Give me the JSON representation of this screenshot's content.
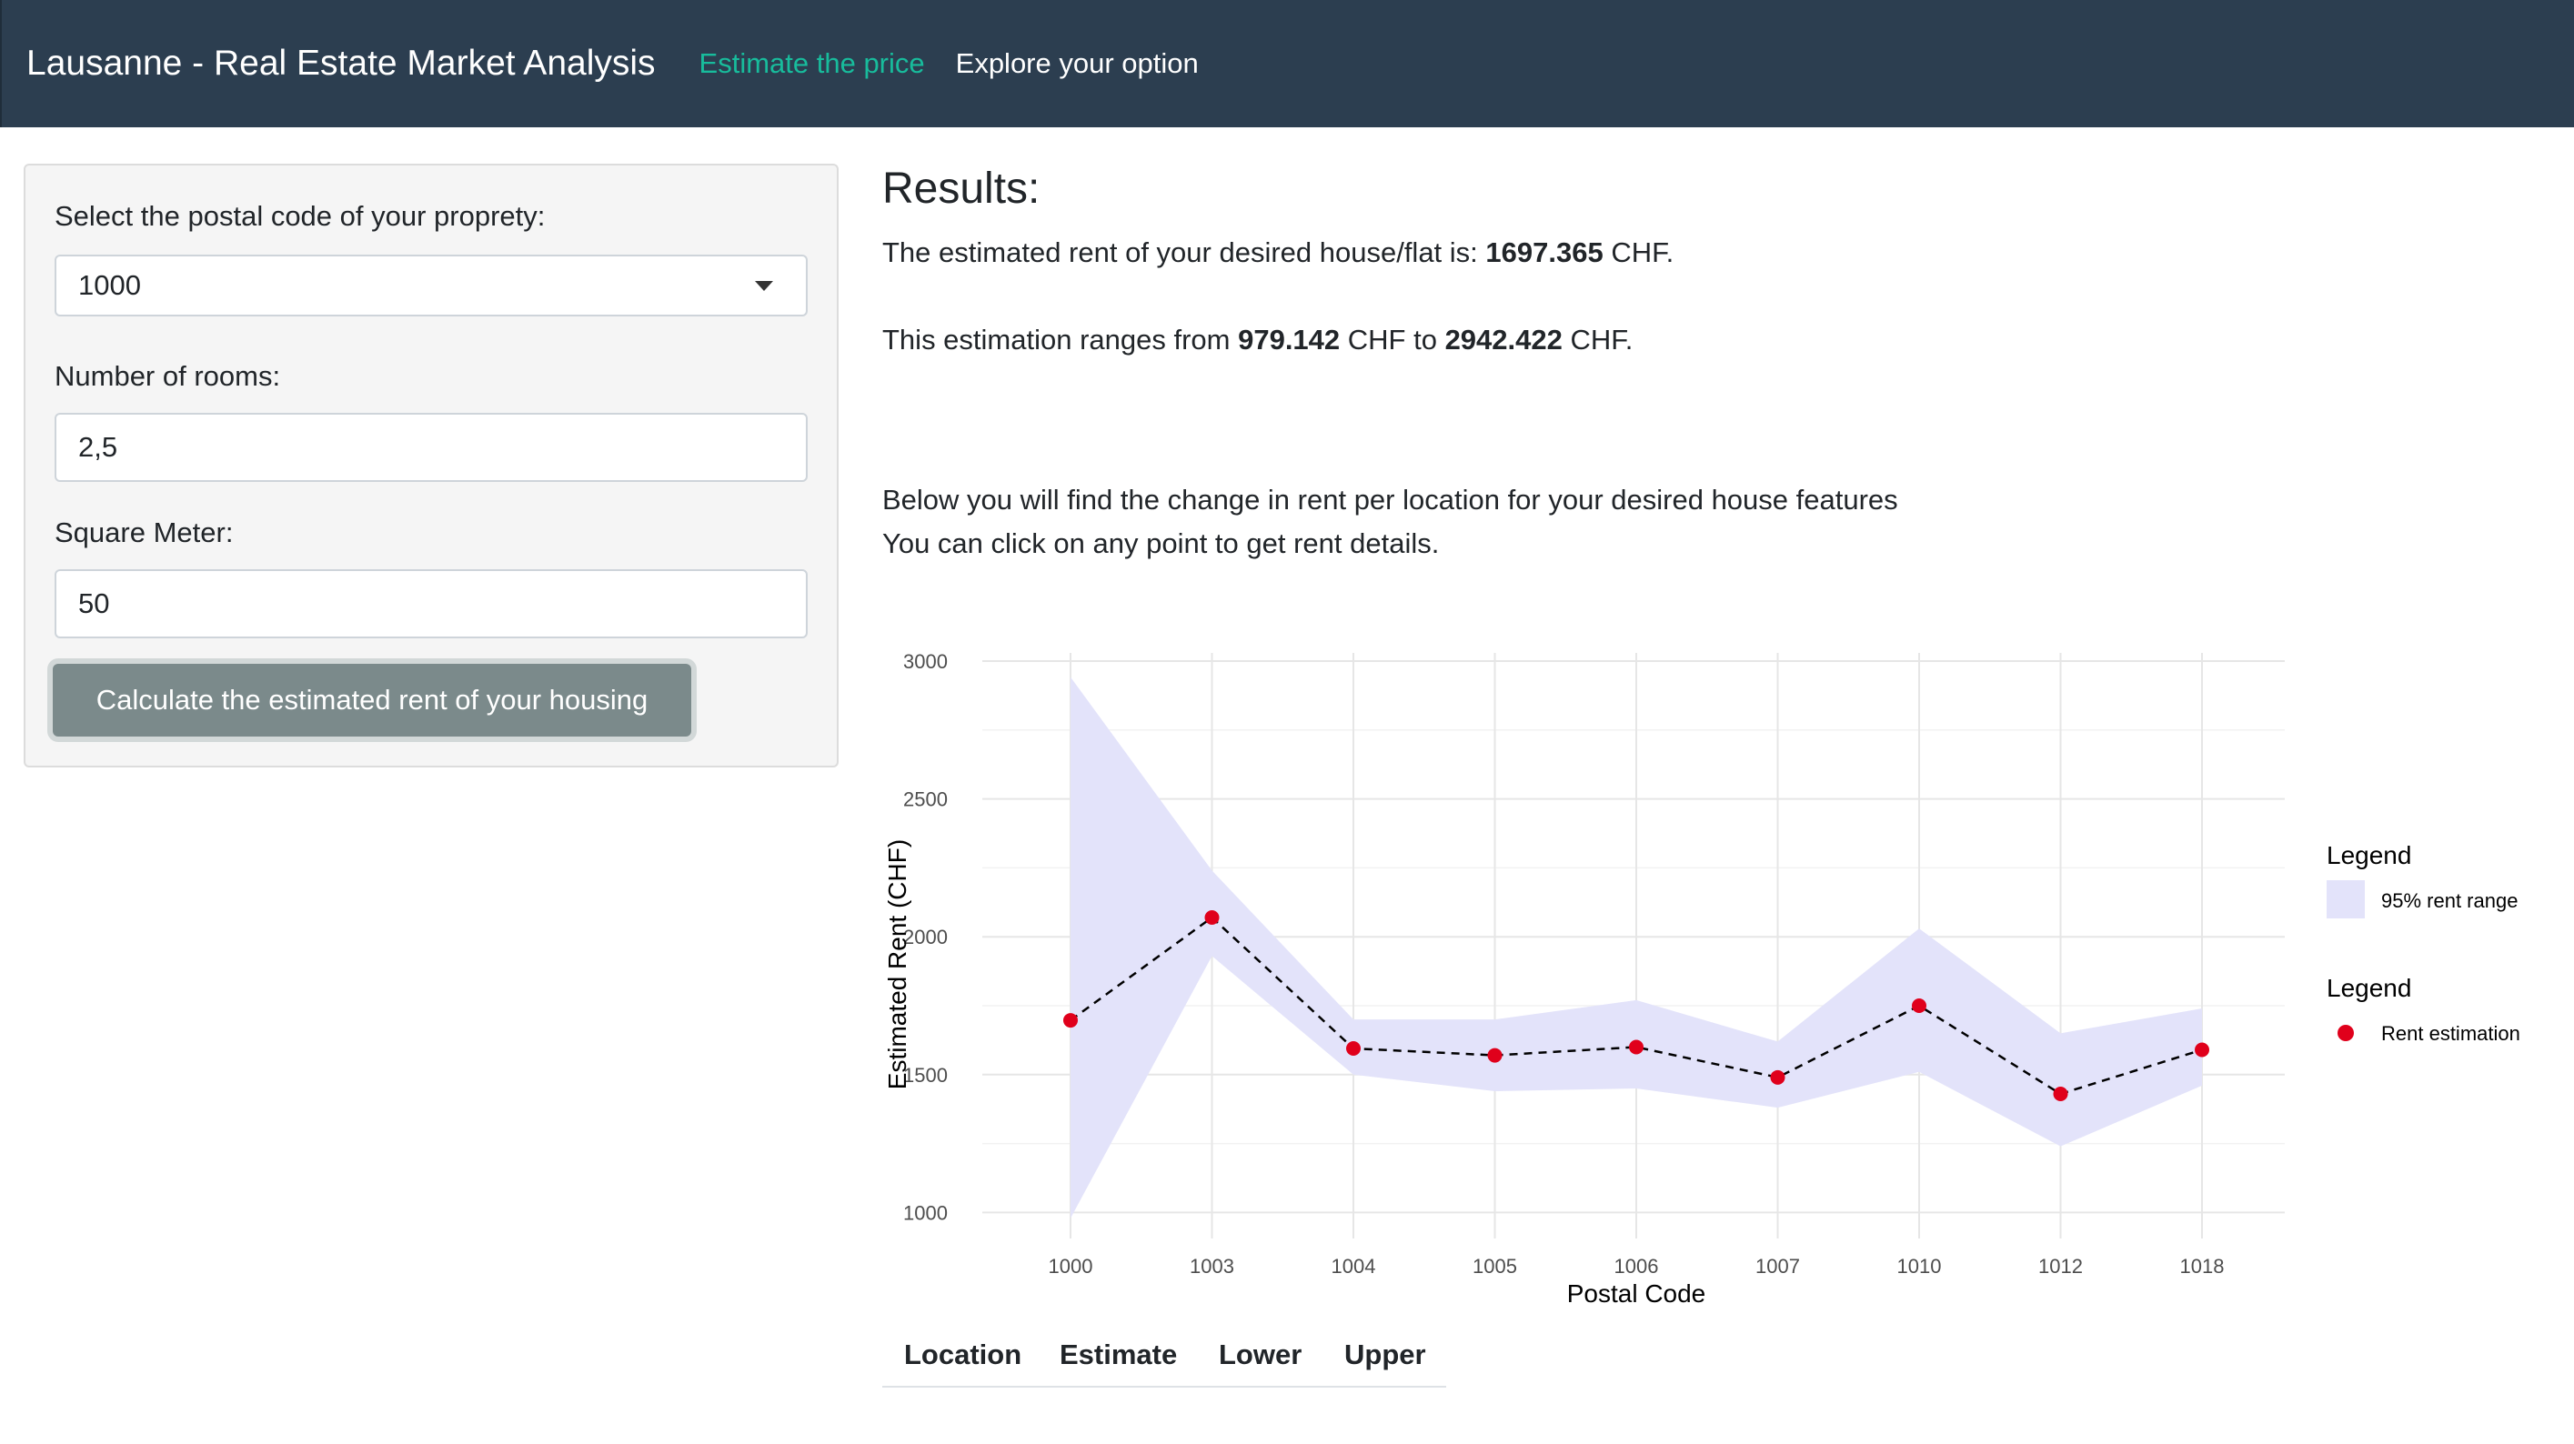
{
  "navbar": {
    "brand": "Lausanne - Real Estate Market Analysis",
    "tabs": [
      {
        "label": "Estimate the price",
        "active": true
      },
      {
        "label": "Explore your option",
        "active": false
      }
    ]
  },
  "sidebar": {
    "postal_label": "Select the postal code of your proprety:",
    "postal_value": "1000",
    "rooms_label": "Number of rooms:",
    "rooms_value": "2,5",
    "sqm_label": "Square Meter:",
    "sqm_value": "50",
    "button_label": "Calculate the estimated rent of your housing"
  },
  "results": {
    "title": "Results:",
    "estimate_prefix": "The estimated rent of your desired house/flat is: ",
    "estimate_value": "1697.365",
    "estimate_suffix": " CHF.",
    "range_prefix": "This estimation ranges from ",
    "range_low": "979.142",
    "range_mid": " CHF to ",
    "range_high": "2942.422",
    "range_suffix": " CHF.",
    "below_text": "Below you will find the change in rent per location for your desired house features",
    "click_text": "You can click on any point to get rent details."
  },
  "colors": {
    "navbar": "#2c3e50",
    "active_tab": "#18bc9c",
    "ribbon": "#e3e3fa",
    "point": "#e0001b"
  },
  "chart_data": {
    "type": "line",
    "xlabel": "Postal Code",
    "ylabel": "Estimated Rent (CHF)",
    "categories": [
      "1000",
      "1003",
      "1004",
      "1005",
      "1006",
      "1007",
      "1010",
      "1012",
      "1018"
    ],
    "ylim": [
      950,
      3050
    ],
    "yticks": [
      1000,
      1500,
      2000,
      2500,
      3000
    ],
    "grid": true,
    "series": [
      {
        "name": "Rent estimation",
        "values": [
          1697,
          2070,
          1595,
          1570,
          1600,
          1490,
          1750,
          1430,
          1590
        ]
      }
    ],
    "ribbon": {
      "name": "95% rent range",
      "lower": [
        979,
        1930,
        1500,
        1440,
        1450,
        1380,
        1510,
        1240,
        1460
      ],
      "upper": [
        2942,
        2240,
        1700,
        1700,
        1770,
        1620,
        2030,
        1650,
        1740
      ]
    },
    "legend": [
      {
        "title": "Legend",
        "label": "95% rent range"
      },
      {
        "title": "Legend",
        "label": "Rent estimation"
      }
    ],
    "legend_position": "right"
  },
  "table": {
    "headers": [
      "Location",
      "Estimate",
      "Lower",
      "Upper"
    ]
  }
}
